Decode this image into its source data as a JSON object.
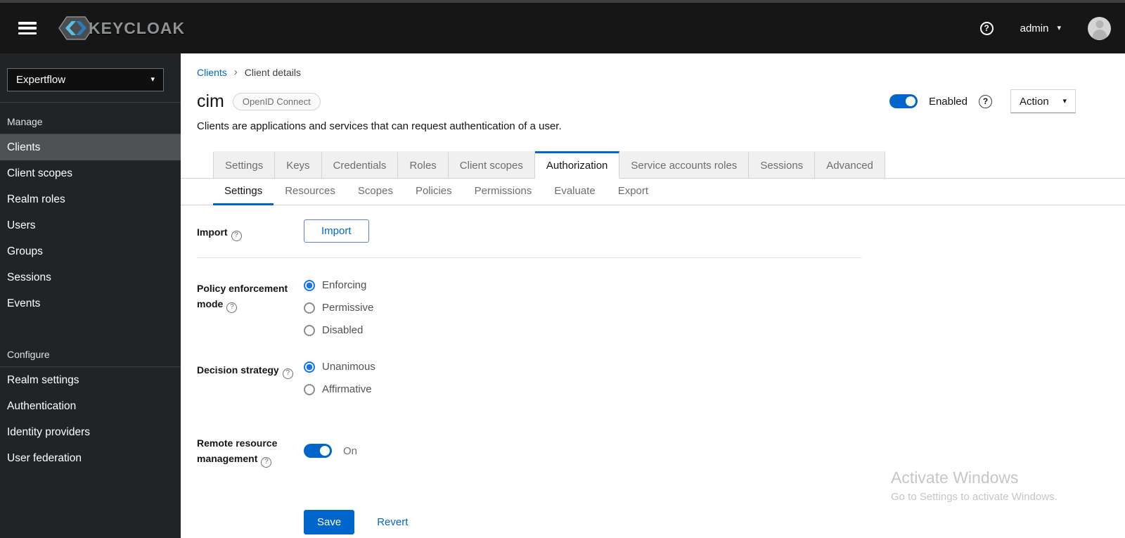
{
  "header": {
    "brand": "KEYCLOAK",
    "user": "admin"
  },
  "icons": {
    "help": "?",
    "caret_down": "▾",
    "breadcrumb_separator": "›"
  },
  "sidebar": {
    "realm_select": "Expertflow",
    "groups": [
      {
        "label": "Manage",
        "items": [
          "Clients",
          "Client scopes",
          "Realm roles",
          "Users",
          "Groups",
          "Sessions",
          "Events"
        ],
        "active_item": "Clients"
      },
      {
        "label": "Configure",
        "items": [
          "Realm settings",
          "Authentication",
          "Identity providers",
          "User federation"
        ],
        "active_item": ""
      }
    ]
  },
  "breadcrumb": {
    "link": "Clients",
    "current": "Client details"
  },
  "page": {
    "title": "cim",
    "badge": "OpenID Connect",
    "description": "Clients are applications and services that can request authentication of a user.",
    "enabled_label": "Enabled",
    "action_label": "Action"
  },
  "tabs": {
    "main": [
      "Settings",
      "Keys",
      "Credentials",
      "Roles",
      "Client scopes",
      "Authorization",
      "Service accounts roles",
      "Sessions",
      "Advanced"
    ],
    "main_active": "Authorization",
    "sub": [
      "Settings",
      "Resources",
      "Scopes",
      "Policies",
      "Permissions",
      "Evaluate",
      "Export"
    ],
    "sub_active": "Settings"
  },
  "form": {
    "import": {
      "label": "Import",
      "button": "Import"
    },
    "policy_enforcement": {
      "label": "Policy enforcement mode",
      "options": [
        "Enforcing",
        "Permissive",
        "Disabled"
      ],
      "selected": "Enforcing"
    },
    "decision_strategy": {
      "label": "Decision strategy",
      "options": [
        "Unanimous",
        "Affirmative"
      ],
      "selected": "Unanimous"
    },
    "remote_resource": {
      "label": "Remote resource management",
      "state": "On"
    },
    "save_label": "Save",
    "revert_label": "Revert"
  },
  "watermark": {
    "line1": "Activate Windows",
    "line2": "Go to Settings to activate Windows."
  },
  "colors": {
    "accent_blue": "#0066cc",
    "header_bg": "#161616",
    "sidebar_bg": "#212427",
    "sidebar_active": "#4f5255",
    "tab_inactive_bg": "#f0f0f0",
    "radio_checked": "#1a73e8"
  }
}
